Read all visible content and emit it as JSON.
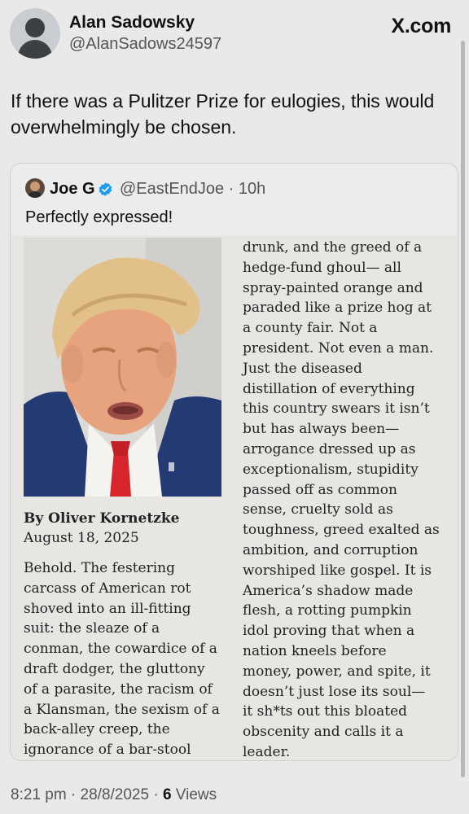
{
  "post": {
    "display_name": "Alan Sadowsky",
    "handle": "@AlanSadows24597",
    "brand": "X.com",
    "text": "If there was a Pulitzer Prize for eulogies, this would overwhelmingly be chosen.",
    "avatar_icon": "default-avatar-icon"
  },
  "quoted": {
    "display_name": "Joe G",
    "handle_time": "@EastEndJoe · 10h",
    "text": "Perfectly expressed!",
    "verified_color": "#1d9bf0",
    "article": {
      "byline": "By Oliver Kornetzke",
      "date": "August 18, 2025",
      "col_left": "Behold. The festering\ncarcass of American rot\nshoved into an ill-fitting\nsuit: the sleaze of a\nconman, the cowardice of a\ndraft dodger, the gluttony\nof a parasite, the racism of\na Klansman, the sexism of a\nback-alley creep, the\nignorance of a bar-stool",
      "col_right": "drunk, and the greed of a\nhedge-fund ghoul— all\nspray-painted orange and\nparaded like a prize hog at\na county fair. Not a\npresident. Not even a man.\nJust the diseased\ndistillation of everything\nthis country swears it isn’t\nbut has always been—\narrogance dressed up as\nexceptionalism, stupidity\npassed off as common\nsense, cruelty sold as\ntoughness, greed exalted as\nambition, and corruption\nworshiped like gospel. It is\nAmerica’s shadow made\nflesh, a rotting pumpkin\nidol proving that when a\nnation kneels before\nmoney, power, and spite, it\ndoesn’t just lose its soul—\nit sh*ts out this bloated\nobscenity and calls it a\nleader."
    }
  },
  "meta": {
    "time_date": "8:21 pm · 28/8/2025 · ",
    "views_count": "6",
    "views_label": " Views"
  }
}
